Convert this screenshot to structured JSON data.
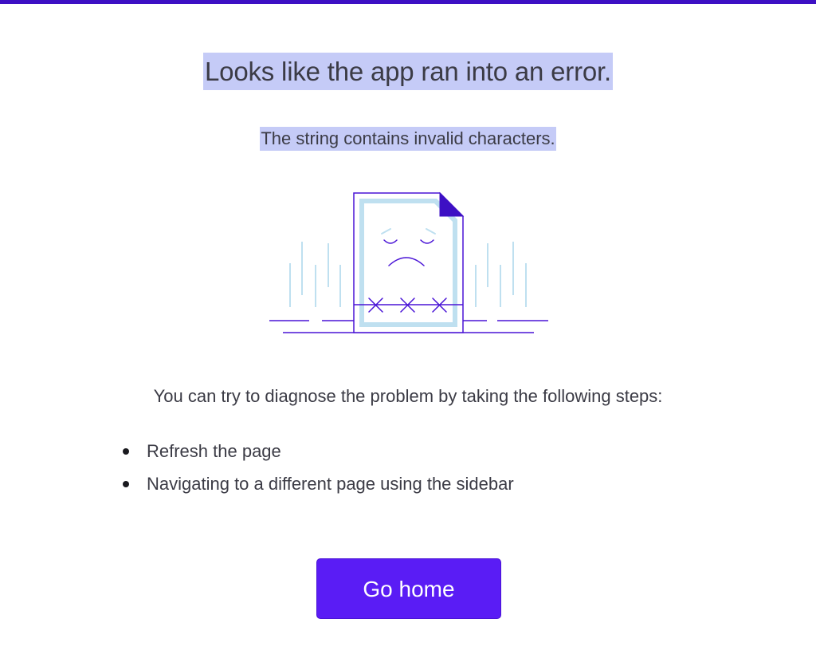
{
  "error": {
    "title": "Looks like the app ran into an error.",
    "message": "The string contains invalid characters."
  },
  "illustration": {
    "icon": "sad-document-icon"
  },
  "help": {
    "intro": "You can try to diagnose the problem by taking the following steps:",
    "steps": [
      "Refresh the page",
      "Navigating to a different page using the sidebar"
    ]
  },
  "actions": {
    "go_home_label": "Go home"
  },
  "colors": {
    "accent": "#5a1cf5",
    "top_bar": "#3d10c4",
    "highlight": "#c5cbf7",
    "illustration_line": "#4a14d6",
    "illustration_fill": "#bfe0f0"
  }
}
